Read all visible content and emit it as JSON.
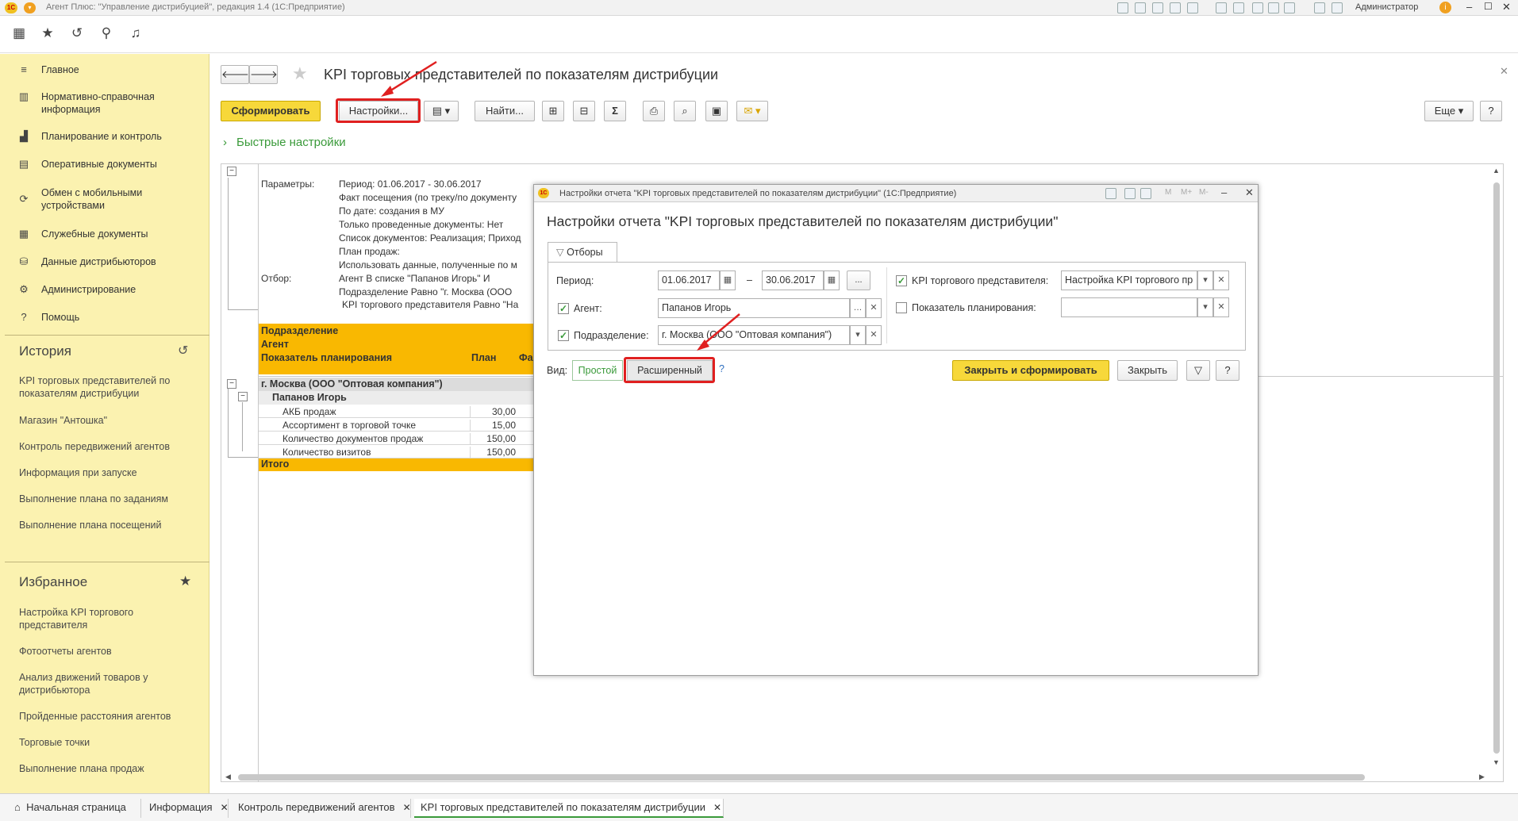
{
  "window": {
    "title": "Агент Плюс: \"Управление дистрибуцией\", редакция 1.4  (1С:Предприятие)",
    "user": "Администратор"
  },
  "sidebar": {
    "items": [
      {
        "label": "Главное",
        "icon": "menu-lines-icon"
      },
      {
        "label": "Нормативно-справочная информация",
        "icon": "bars-chart-icon"
      },
      {
        "label": "Планирование и контроль",
        "icon": "chart-icon"
      },
      {
        "label": "Оперативные документы",
        "icon": "folder-icon"
      },
      {
        "label": "Обмен с мобильными устройствами",
        "icon": "sync-icon"
      },
      {
        "label": "Служебные документы",
        "icon": "document-icon"
      },
      {
        "label": "Данные дистрибьюторов",
        "icon": "network-icon"
      },
      {
        "label": "Администрирование",
        "icon": "gear-icon"
      },
      {
        "label": "Помощь",
        "icon": "help-icon"
      }
    ],
    "history_title": "История",
    "history": [
      "KPI торговых представителей по показателям дистрибуции",
      "Магазин \"Антошка\"",
      "Контроль передвижений агентов",
      "Информация при запуске",
      "Выполнение плана по заданиям",
      "Выполнение плана посещений"
    ],
    "favorites_title": "Избранное",
    "favorites": [
      "Настройка KPI торгового представителя",
      "Фотоотчеты агентов",
      "Анализ движений товаров у дистрибьютора",
      "Пройденные расстояния агентов",
      "Торговые точки",
      "Выполнение плана продаж"
    ]
  },
  "main": {
    "title": "KPI торговых представителей по показателям дистрибуции",
    "btn_generate": "Сформировать",
    "btn_settings": "Настройки...",
    "btn_find": "Найти...",
    "btn_more": "Еще",
    "btn_help": "?",
    "quick_settings": "Быстрые настройки"
  },
  "report": {
    "params_label": "Параметры:",
    "params": [
      "Период: 01.06.2017 - 30.06.2017",
      "Факт посещения (по треку/по документу",
      "По дате: создания в МУ",
      "Только проведенные документы: Нет",
      "Список документов: Реализация; Приход",
      "План продаж:",
      "Использовать данные, полученные по м"
    ],
    "filter_label": "Отбор:",
    "filters": [
      "Агент В списке \"Папанов Игорь\" И",
      "Подразделение Равно \"г. Москва  (ООО",
      "KPI торгового представителя Равно \"На"
    ],
    "hdr": [
      "Подразделение",
      "Агент",
      "Показатель планирования"
    ],
    "col_plan": "План",
    "col_fact": "Фа",
    "group": "г. Москва  (ООО \"Оптовая компания\")",
    "agent": "Папанов Игорь",
    "rows": [
      {
        "name": "АКБ продаж",
        "plan": "30,00"
      },
      {
        "name": "Ассортимент в торговой точке",
        "plan": "15,00"
      },
      {
        "name": "Количество документов продаж",
        "plan": "150,00"
      },
      {
        "name": "Количество визитов",
        "plan": "150,00"
      }
    ],
    "total": "Итого"
  },
  "dialog": {
    "window_title": "Настройки отчета \"KPI торговых представителей по показателям дистрибуции\"  (1С:Предприятие)",
    "title": "Настройки отчета \"KPI торговых представителей по показателям дистрибуции\"",
    "tab": "Отборы",
    "period_label": "Период:",
    "date_from": "01.06.2017",
    "dash": "–",
    "date_to": "30.06.2017",
    "ellipsis": "...",
    "agent_label": "Агент:",
    "agent_value": "Папанов Игорь",
    "dept_label": "Подразделение:",
    "dept_value": "г. Москва  (ООО \"Оптовая компания\")",
    "kpi_label": "KPI торгового представителя:",
    "kpi_value": "Настройка KPI торгового пр",
    "plan_label": "Показатель планирования:",
    "plan_value": "",
    "view_label": "Вид:",
    "view_simple": "Простой",
    "view_extended": "Расширенный",
    "view_help": "?",
    "btn_close_generate": "Закрыть и сформировать",
    "btn_close": "Закрыть",
    "btn_help": "?"
  },
  "tabs": [
    {
      "label": "Начальная страница"
    },
    {
      "label": "Информация"
    },
    {
      "label": "Контроль передвижений агентов"
    },
    {
      "label": "KPI торговых представителей по показателям дистрибуции"
    }
  ],
  "colors": {
    "accent_yellow": "#f7d83a",
    "sidebar": "#fbf2b0",
    "report_header": "#f9b801",
    "link_green": "#3a9a3a",
    "highlight_red": "#e02020"
  }
}
